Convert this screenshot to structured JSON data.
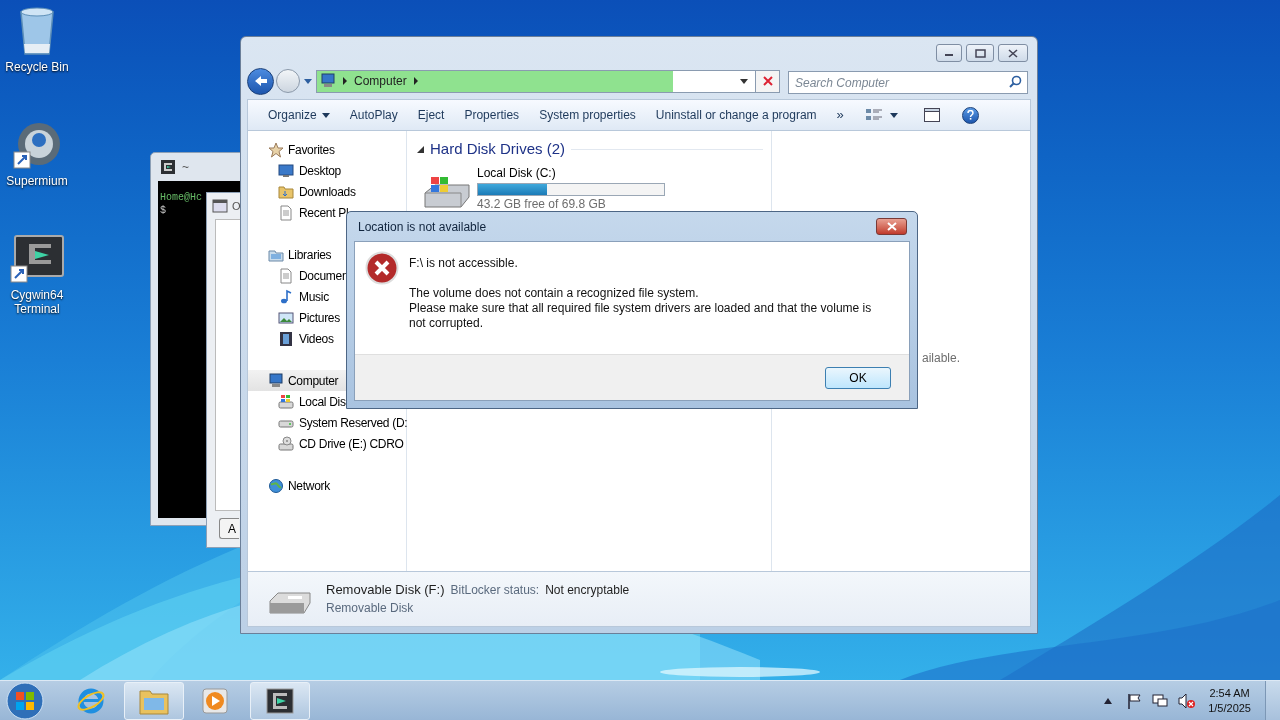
{
  "desktop_icons": [
    {
      "label": "Recycle Bin"
    },
    {
      "label": "Supermium"
    },
    {
      "label": "Cygwin64 Terminal"
    }
  ],
  "terminal": {
    "title": "~",
    "lines": [
      "Home@Hc",
      "$"
    ]
  },
  "back_window": {
    "title": "O",
    "button": "A"
  },
  "explorer": {
    "address": {
      "crumbs": [
        "Computer"
      ],
      "level": 0.77
    },
    "search": {
      "placeholder": "Search Computer"
    },
    "toolbar": [
      {
        "label": "Organize",
        "dropdown": true
      },
      {
        "label": "AutoPlay",
        "dropdown": false
      },
      {
        "label": "Eject",
        "dropdown": false
      },
      {
        "label": "Properties",
        "dropdown": false
      },
      {
        "label": "System properties",
        "dropdown": false
      },
      {
        "label": "Uninstall or change a program",
        "dropdown": false
      }
    ],
    "overflow": "»",
    "nav": [
      {
        "label": "Favorites",
        "selected": false,
        "children": [
          {
            "label": "Desktop"
          },
          {
            "label": "Downloads"
          },
          {
            "label": "Recent Pl"
          }
        ]
      },
      {
        "label": "Libraries",
        "selected": false,
        "children": [
          {
            "label": "Documen"
          },
          {
            "label": "Music"
          },
          {
            "label": "Pictures"
          },
          {
            "label": "Videos"
          }
        ]
      },
      {
        "label": "Computer",
        "selected": true,
        "children": [
          {
            "label": "Local Dis"
          },
          {
            "label": "System Reserved (D:"
          },
          {
            "label": "CD Drive (E:) CDRO"
          }
        ]
      },
      {
        "label": "Network",
        "selected": false
      }
    ],
    "group": {
      "title": "Hard Disk Drives (2)",
      "expanded": true
    },
    "drives": [
      {
        "name": "Local Disk (C:)",
        "level": 0.37,
        "free": "43.2 GB free of 69.8 GB"
      }
    ],
    "preview_text": "ailable.",
    "details": {
      "name": "Removable Disk (F:)",
      "field_label": "BitLocker status:",
      "field_value": "Not encryptable",
      "type": "Removable Disk"
    }
  },
  "dialog": {
    "title": "Location is not available",
    "heading": "F:\\ is not accessible.",
    "lines": [
      "The volume does not contain a recognized file system.",
      "Please make sure that all required file system drivers are loaded and that the volume is not corrupted."
    ],
    "button": "OK"
  },
  "taskbar": {
    "apps": [
      {
        "running": false
      },
      {
        "running": true
      },
      {
        "running": false
      },
      {
        "running": true
      }
    ],
    "clock": {
      "time": "2:54 AM",
      "date": "1/5/2025"
    }
  }
}
